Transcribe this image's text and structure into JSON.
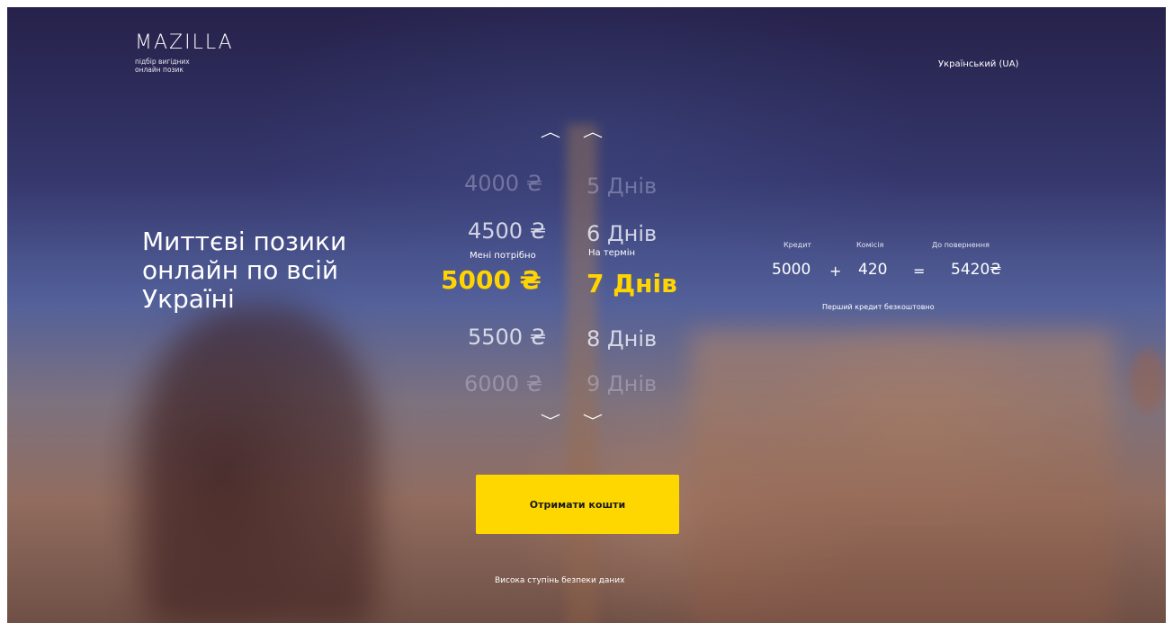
{
  "header": {
    "logo_text": "MAZILLA",
    "logo_tagline_line1": "підбір вигідних",
    "logo_tagline_line2": "онлайн позик",
    "language": "Український (UA)"
  },
  "hero": {
    "headline": "Миттєві позики онлайн по всій Україні"
  },
  "amount_picker": {
    "caption": "Мені потрібно",
    "options": [
      "4000 ₴",
      "4500 ₴",
      "5000 ₴",
      "5500 ₴",
      "6000 ₴"
    ],
    "selected": "5000 ₴"
  },
  "term_picker": {
    "caption": "На термін",
    "options": [
      "5 Днів",
      "6 Днів",
      "7 Днів",
      "8 Днів",
      "9 Днів"
    ],
    "selected": "7 Днів"
  },
  "summary": {
    "credit_label": "Кредит",
    "commission_label": "Комісія",
    "repay_label": "До повернення",
    "credit_value": "5000",
    "plus": "+",
    "commission_value": "420",
    "equals": "=",
    "repay_value": "5420₴",
    "note": "Перший кредит безкоштовно"
  },
  "cta": {
    "label": "Отримати кошти"
  },
  "footer": {
    "security_text": "Висока ступінь безпеки даних"
  },
  "colors": {
    "accent": "#ffd400",
    "button": "#ffd700",
    "text": "#ffffff"
  }
}
